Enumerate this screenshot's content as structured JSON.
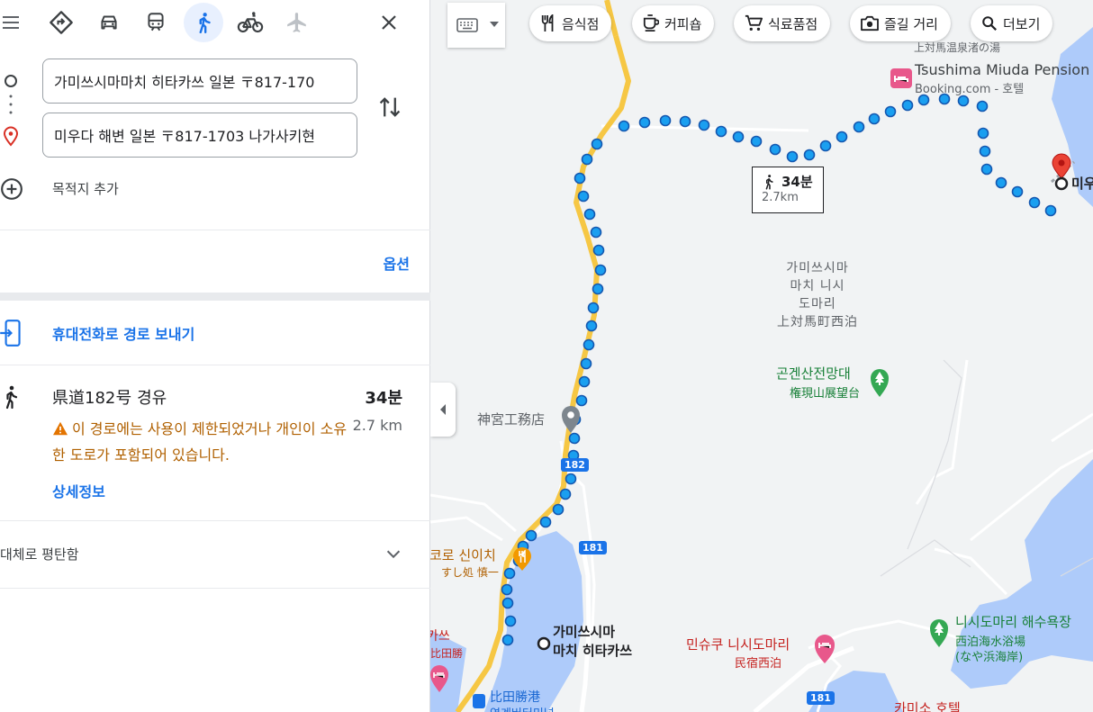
{
  "travel_modes": [
    {
      "name": "best",
      "icon": "diamond-directions-icon"
    },
    {
      "name": "driving",
      "icon": "car-icon"
    },
    {
      "name": "transit",
      "icon": "train-icon"
    },
    {
      "name": "walking",
      "icon": "walk-icon",
      "active": true
    },
    {
      "name": "cycling",
      "icon": "bicycle-icon"
    },
    {
      "name": "flights",
      "icon": "airplane-icon",
      "disabled": true
    }
  ],
  "origin": {
    "value": "가미쓰시마마치 히타카쓰 일본 〒817-170"
  },
  "destination": {
    "value": "미우다 해변 일본 〒817-1703 나가사키현"
  },
  "add_destination_label": "목적지 추가",
  "options_label": "옵션",
  "send_to_phone_label": "휴대전화로 경로 보내기",
  "route": {
    "via": "県道182号 경유",
    "time": "34분",
    "distance": "2.7 km",
    "warning": "이 경로에는 사용이 제한되었거나 개인이 소유한 도로가 포함되어 있습니다.",
    "details_label": "상세정보",
    "terrain": "대체로 평탄함"
  },
  "map": {
    "chips": [
      "음식점",
      "커피숍",
      "식료품점",
      "즐길 거리",
      "더보기"
    ],
    "route_badge": {
      "time": "34분",
      "distance": "2.7km"
    },
    "labels": {
      "district": [
        "가미쓰시마",
        "마치 니시",
        "도마리",
        "上対馬町西泊"
      ],
      "gongen_ko": "곤겐산전망대",
      "gongen_ja": "権現山展望台",
      "jingu": "神宮工務店",
      "pension_name": "Tsushima Miuda Pension",
      "pension_sub": "Booking.com - 호텔",
      "onsen": "上対馬温泉渚の湯",
      "origin_label": [
        "가미쓰시마",
        "마치 히타카쓰"
      ],
      "dest_label": "미우",
      "minshuku_ko": "민슈쿠 니시도마리",
      "minshuku_ja": "民宿西泊",
      "beach_ko": "니시도마리 해수욕장",
      "beach_ja1": "西泊海水浴場",
      "beach_ja2": "(なや浜海岸)",
      "sushi_ko": "코로 신이치",
      "sushi_ja": "すし処 慎一",
      "port": "比田勝港",
      "port2": "연계버터미널",
      "hotel": "카미소 호텔",
      "left_frag1": "카쓰",
      "left_frag2": "比田勝",
      "road_182": "182",
      "road_181a": "181",
      "road_181b": "181"
    }
  }
}
